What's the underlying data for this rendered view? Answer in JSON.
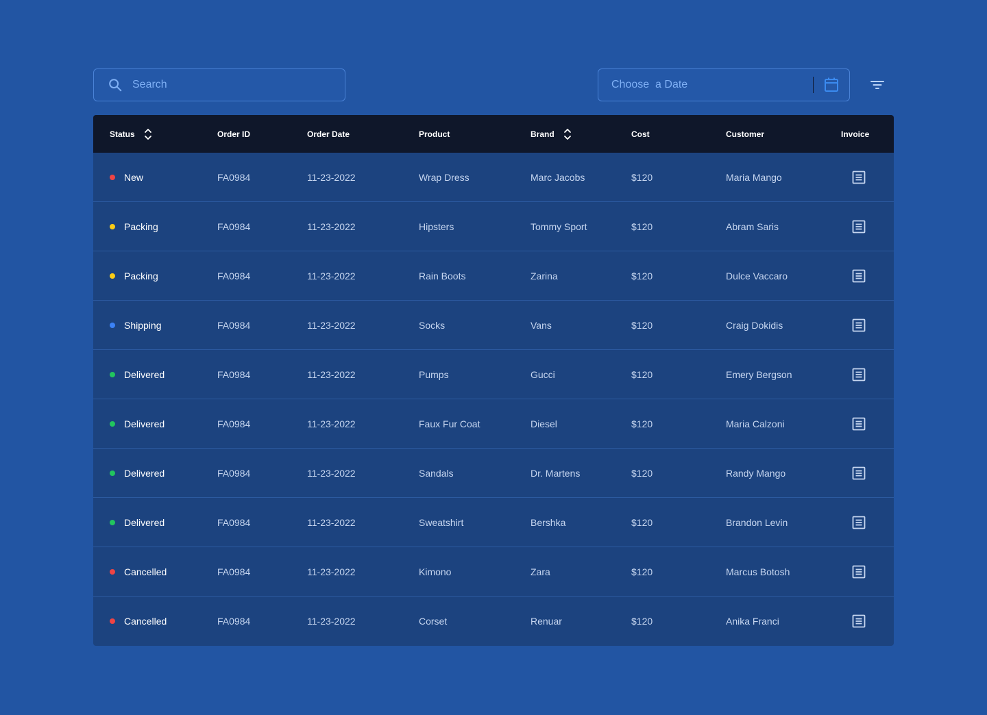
{
  "search": {
    "placeholder": "Search",
    "icon": "search-icon"
  },
  "date_picker": {
    "placeholder": "Choose  a Date",
    "icon": "calendar-icon"
  },
  "filter": {
    "icon": "filter-icon"
  },
  "colors": {
    "background": "#2255a3",
    "header_bg": "#0f172a",
    "table_bg": "#1c437f",
    "status_new": "#ef4444",
    "status_packing": "#facc15",
    "status_shipping": "#3b82f6",
    "status_delivered": "#22c55e",
    "status_cancelled": "#ef4444"
  },
  "table": {
    "headers": {
      "status": "Status",
      "order_id": "Order ID",
      "order_date": "Order Date",
      "product": "Product",
      "brand": "Brand",
      "cost": "Cost",
      "customer": "Customer",
      "invoice": "Invoice"
    },
    "rows": [
      {
        "status": "New",
        "status_color": "#ef4444",
        "order_id": "FA0984",
        "order_date": "11-23-2022",
        "product": "Wrap Dress",
        "brand": "Marc Jacobs",
        "cost": "$120",
        "customer": "Maria Mango"
      },
      {
        "status": "Packing",
        "status_color": "#facc15",
        "order_id": "FA0984",
        "order_date": "11-23-2022",
        "product": "Hipsters",
        "brand": "Tommy Sport",
        "cost": "$120",
        "customer": "Abram Saris"
      },
      {
        "status": "Packing",
        "status_color": "#facc15",
        "order_id": "FA0984",
        "order_date": "11-23-2022",
        "product": "Rain Boots",
        "brand": "Zarina",
        "cost": "$120",
        "customer": "Dulce Vaccaro"
      },
      {
        "status": "Shipping",
        "status_color": "#3b82f6",
        "order_id": "FA0984",
        "order_date": "11-23-2022",
        "product": "Socks",
        "brand": "Vans",
        "cost": "$120",
        "customer": "Craig Dokidis"
      },
      {
        "status": "Delivered",
        "status_color": "#22c55e",
        "order_id": "FA0984",
        "order_date": "11-23-2022",
        "product": "Pumps",
        "brand": "Gucci",
        "cost": "$120",
        "customer": "Emery Bergson"
      },
      {
        "status": "Delivered",
        "status_color": "#22c55e",
        "order_id": "FA0984",
        "order_date": "11-23-2022",
        "product": "Faux Fur Coat",
        "brand": "Diesel",
        "cost": "$120",
        "customer": "Maria Calzoni"
      },
      {
        "status": "Delivered",
        "status_color": "#22c55e",
        "order_id": "FA0984",
        "order_date": "11-23-2022",
        "product": "Sandals",
        "brand": "Dr. Martens",
        "cost": "$120",
        "customer": "Randy Mango"
      },
      {
        "status": "Delivered",
        "status_color": "#22c55e",
        "order_id": "FA0984",
        "order_date": "11-23-2022",
        "product": "Sweatshirt",
        "brand": "Bershka",
        "cost": "$120",
        "customer": "Brandon Levin"
      },
      {
        "status": "Cancelled",
        "status_color": "#ef4444",
        "order_id": "FA0984",
        "order_date": "11-23-2022",
        "product": "Kimono",
        "brand": "Zara",
        "cost": "$120",
        "customer": "Marcus Botosh"
      },
      {
        "status": "Cancelled",
        "status_color": "#ef4444",
        "order_id": "FA0984",
        "order_date": "11-23-2022",
        "product": "Corset",
        "brand": "Renuar",
        "cost": "$120",
        "customer": "Anika Franci"
      }
    ]
  }
}
